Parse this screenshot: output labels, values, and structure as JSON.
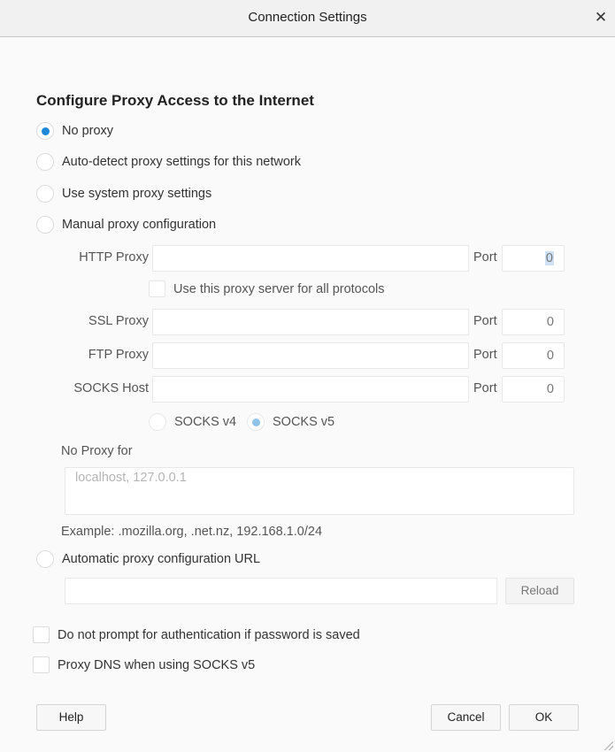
{
  "window": {
    "title": "Connection Settings",
    "close_icon": "close-icon"
  },
  "heading": "Configure Proxy Access to the Internet",
  "proxy_modes": [
    {
      "label": "No proxy",
      "checked": true
    },
    {
      "label": "Auto-detect proxy settings for this network",
      "checked": false
    },
    {
      "label": "Use system proxy settings",
      "checked": false
    },
    {
      "label": "Manual proxy configuration",
      "checked": false
    }
  ],
  "manual": {
    "http_label": "HTTP Proxy",
    "http_value": "",
    "http_port": "0",
    "use_for_all_label": "Use this proxy server for all protocols",
    "use_for_all_checked": false,
    "ssl_label": "SSL Proxy",
    "ssl_value": "",
    "ssl_port": "0",
    "ftp_label": "FTP Proxy",
    "ftp_value": "",
    "ftp_port": "0",
    "socks_label": "SOCKS Host",
    "socks_value": "",
    "socks_port": "0",
    "port_label": "Port",
    "socks_v4_label": "SOCKS v4",
    "socks_v5_label": "SOCKS v5",
    "socks_version_selected": "SOCKS v5"
  },
  "no_proxy": {
    "label": "No Proxy for",
    "placeholder": "localhost, 127.0.0.1",
    "example": "Example: .mozilla.org, .net.nz, 192.168.1.0/24"
  },
  "auto_config": {
    "label": "Automatic proxy configuration URL",
    "checked": false,
    "url_value": "",
    "reload_label": "Reload"
  },
  "options": {
    "no_auth_prompt_label": "Do not prompt for authentication if password is saved",
    "no_auth_prompt_checked": false,
    "proxy_dns_label": "Proxy DNS when using SOCKS v5",
    "proxy_dns_checked": false
  },
  "buttons": {
    "help": "Help",
    "cancel": "Cancel",
    "ok": "OK"
  },
  "colors": {
    "accent": "#1e88d6",
    "accent_dim": "#8ec4ea"
  }
}
